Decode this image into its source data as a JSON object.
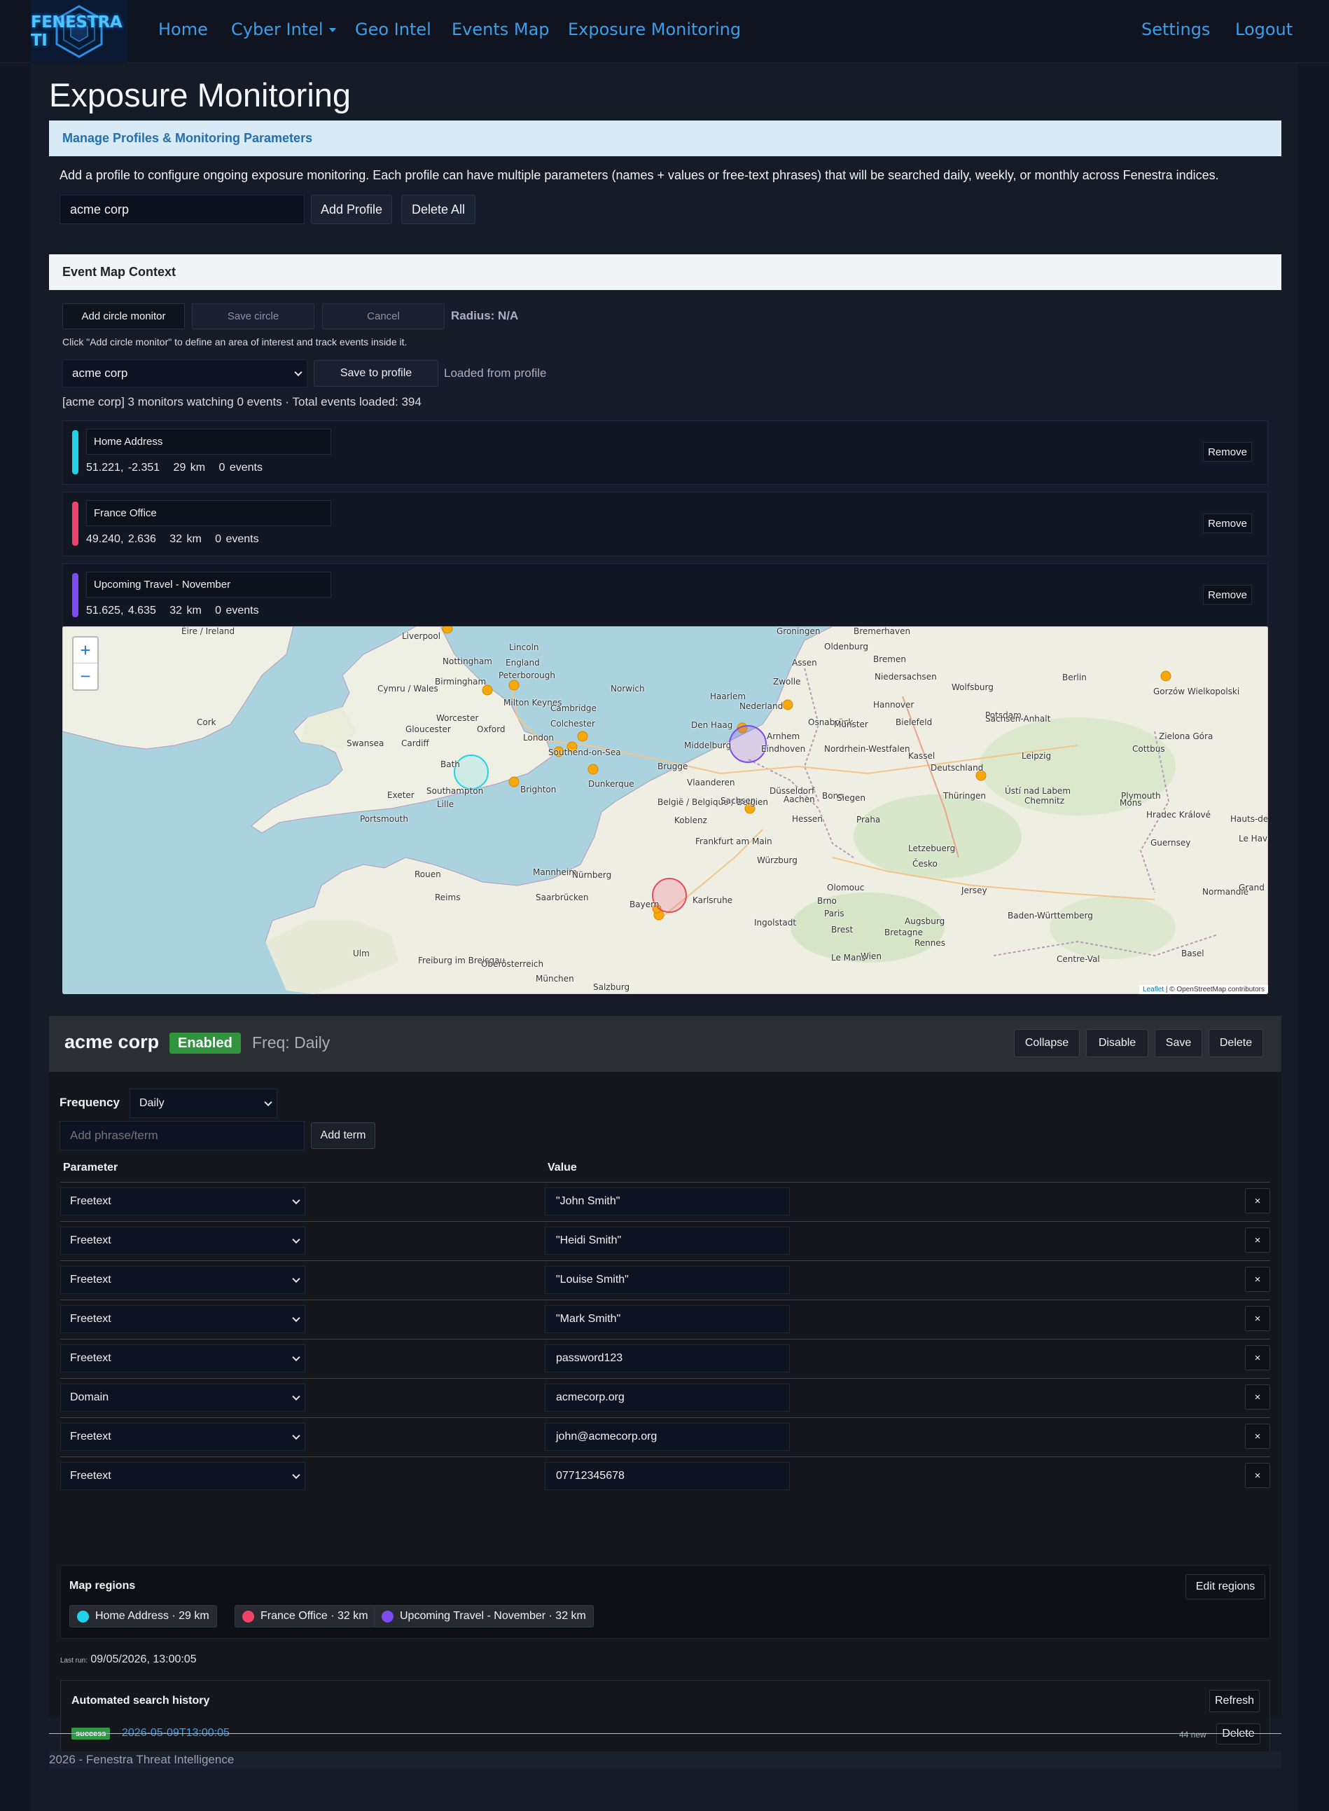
{
  "brand": {
    "name": "FENESTRA TI"
  },
  "nav": {
    "home": "Home",
    "cyber_intel": "Cyber Intel",
    "geo_intel": "Geo Intel",
    "events_map": "Events Map",
    "exposure_monitoring": "Exposure Monitoring",
    "settings": "Settings",
    "logout": "Logout"
  },
  "page": {
    "title": "Exposure Monitoring"
  },
  "manage": {
    "header": "Manage Profiles & Monitoring Parameters",
    "description": "Add a profile to configure ongoing exposure monitoring. Each profile can have multiple parameters (names + values or free-text phrases) that will be searched daily, weekly, or monthly across Fenestra indices.",
    "profile_input_value": "acme corp",
    "add_profile": "Add Profile",
    "delete_all": "Delete All"
  },
  "event_map": {
    "header": "Event Map Context",
    "add_circle": "Add circle monitor",
    "save_circle": "Save circle",
    "cancel": "Cancel",
    "radius": "Radius: N/A",
    "hint": "Click \"Add circle monitor\" to define an area of interest and track events inside it.",
    "profile_select": "acme corp",
    "save_to_profile": "Save to profile",
    "loaded_status": "Loaded from profile",
    "summary": "[acme corp] 3 monitors watching 0 events · Total events loaded: 394",
    "remove_label": "Remove",
    "monitors": [
      {
        "name": "Home Address",
        "coords": "51.221, -2.351",
        "radius": "29 km",
        "events": "0 events",
        "color": "#1fd2e8"
      },
      {
        "name": "France Office",
        "coords": "49.240, 2.636",
        "radius": "32 km",
        "events": "0 events",
        "color": "#f0436c"
      },
      {
        "name": "Upcoming Travel - November",
        "coords": "51.625, 4.635",
        "radius": "32 km",
        "events": "0 events",
        "color": "#7c4bf2"
      }
    ],
    "map": {
      "zoom_in": "+",
      "zoom_out": "−",
      "attribution_leaflet": "Leaflet",
      "attribution_osm": "| © OpenStreetMap contributors",
      "labels": [
        "Éire / Ireland",
        "Liverpool",
        "Groningen",
        "Bremerhaven",
        "Lincoln",
        "Nottingham",
        "England",
        "Peterborough",
        "Oldenburg",
        "Assen",
        "Bremen",
        "Norwich",
        "Birmingham",
        "Cymru / Wales",
        "Milton Keynes",
        "Cambridge",
        "Zwolle",
        "Niedersachsen",
        "Wolfsburg",
        "Berlin",
        "Gorzów Wielkopolski",
        "Cork",
        "Worcester",
        "Oxford",
        "Colchester",
        "Haarlem",
        "Nederland",
        "Osnabrück",
        "Hannover",
        "Potsdam",
        "Gloucester",
        "Den Haag",
        "Arnhem",
        "Münster",
        "Bielefeld",
        "Sachsen-Anhalt",
        "Swansea",
        "Cardiff",
        "London",
        "Middelburg",
        "Eindhoven",
        "Nordrhein-Westfalen",
        "Kassel",
        "Leipzig",
        "Cottbus",
        "Zielona Góra",
        "Bath",
        "Southend-on-Sea",
        "Brugge",
        "Deutschland",
        "Exeter",
        "Southampton",
        "Brighton",
        "Dunkerque",
        "Vlaanderen",
        "Düsseldorf",
        "Aachen",
        "Bonn",
        "Siegen",
        "Thüringen",
        "Chemnitz",
        "Plymouth",
        "Portsmouth",
        "Lille",
        "België / Belgique / Belgien",
        "Sachsen",
        "Ústí nad Labem",
        "Mons",
        "Koblenz",
        "Hessen",
        "Praha",
        "Hradec Králové",
        "Hauts-de-France",
        "Frankfurt am Main",
        "Letzebuerg",
        "Würzburg",
        "Česko",
        "Guernsey",
        "Le Havre",
        "Rouen",
        "Mannheim",
        "Nürnberg",
        "Olomouc",
        "Jersey",
        "Normandie",
        "Reims",
        "Saarbrücken",
        "Karlsruhe",
        "Brno",
        "Paris",
        "Grand Est",
        "Bayern",
        "Ingolstadt",
        "Baden-Württemberg",
        "Augsburg",
        "Brest",
        "Bretagne",
        "Rennes",
        "Ulm",
        "Freiburg im Breisgau",
        "Oberösterreich",
        "Wien",
        "Le Mans",
        "Centre-Val",
        "Basel",
        "München",
        "Salzburg"
      ]
    }
  },
  "profile": {
    "name": "acme corp",
    "status": "Enabled",
    "freq_label": "Freq: Daily",
    "buttons": {
      "collapse": "Collapse",
      "disable": "Disable",
      "save": "Save",
      "delete": "Delete"
    },
    "frequency_label": "Frequency",
    "frequency_value": "Daily",
    "term_placeholder": "Add phrase/term",
    "add_term": "Add term",
    "col_parameter": "Parameter",
    "col_value": "Value",
    "remove_glyph": "×",
    "params": [
      {
        "type": "Freetext",
        "value": "\"John Smith\""
      },
      {
        "type": "Freetext",
        "value": "\"Heidi Smith\""
      },
      {
        "type": "Freetext",
        "value": "\"Louise Smith\""
      },
      {
        "type": "Freetext",
        "value": "\"Mark Smith\""
      },
      {
        "type": "Freetext",
        "value": "password123"
      },
      {
        "type": "Domain",
        "value": "acmecorp.org"
      },
      {
        "type": "Freetext",
        "value": "john@acmecorp.org"
      },
      {
        "type": "Freetext",
        "value": "07712345678"
      }
    ],
    "regions": {
      "title": "Map regions",
      "edit": "Edit regions",
      "items": [
        {
          "label": "Home Address · 29 km",
          "color": "#1fd2e8"
        },
        {
          "label": "France Office · 32 km",
          "color": "#f0436c"
        },
        {
          "label": "Upcoming Travel - November · 32 km",
          "color": "#7c4bf2"
        }
      ]
    },
    "last_run_label": "Last run:",
    "last_run_value": "09/05/2026, 13:00:05",
    "history": {
      "title": "Automated search history",
      "refresh": "Refresh",
      "status": "success",
      "timestamp": "2026-05-09T13:00:05",
      "new_count": "44 new",
      "delete": "Delete"
    }
  },
  "footer": {
    "text": "2026 - Fenestra Threat Intelligence"
  }
}
